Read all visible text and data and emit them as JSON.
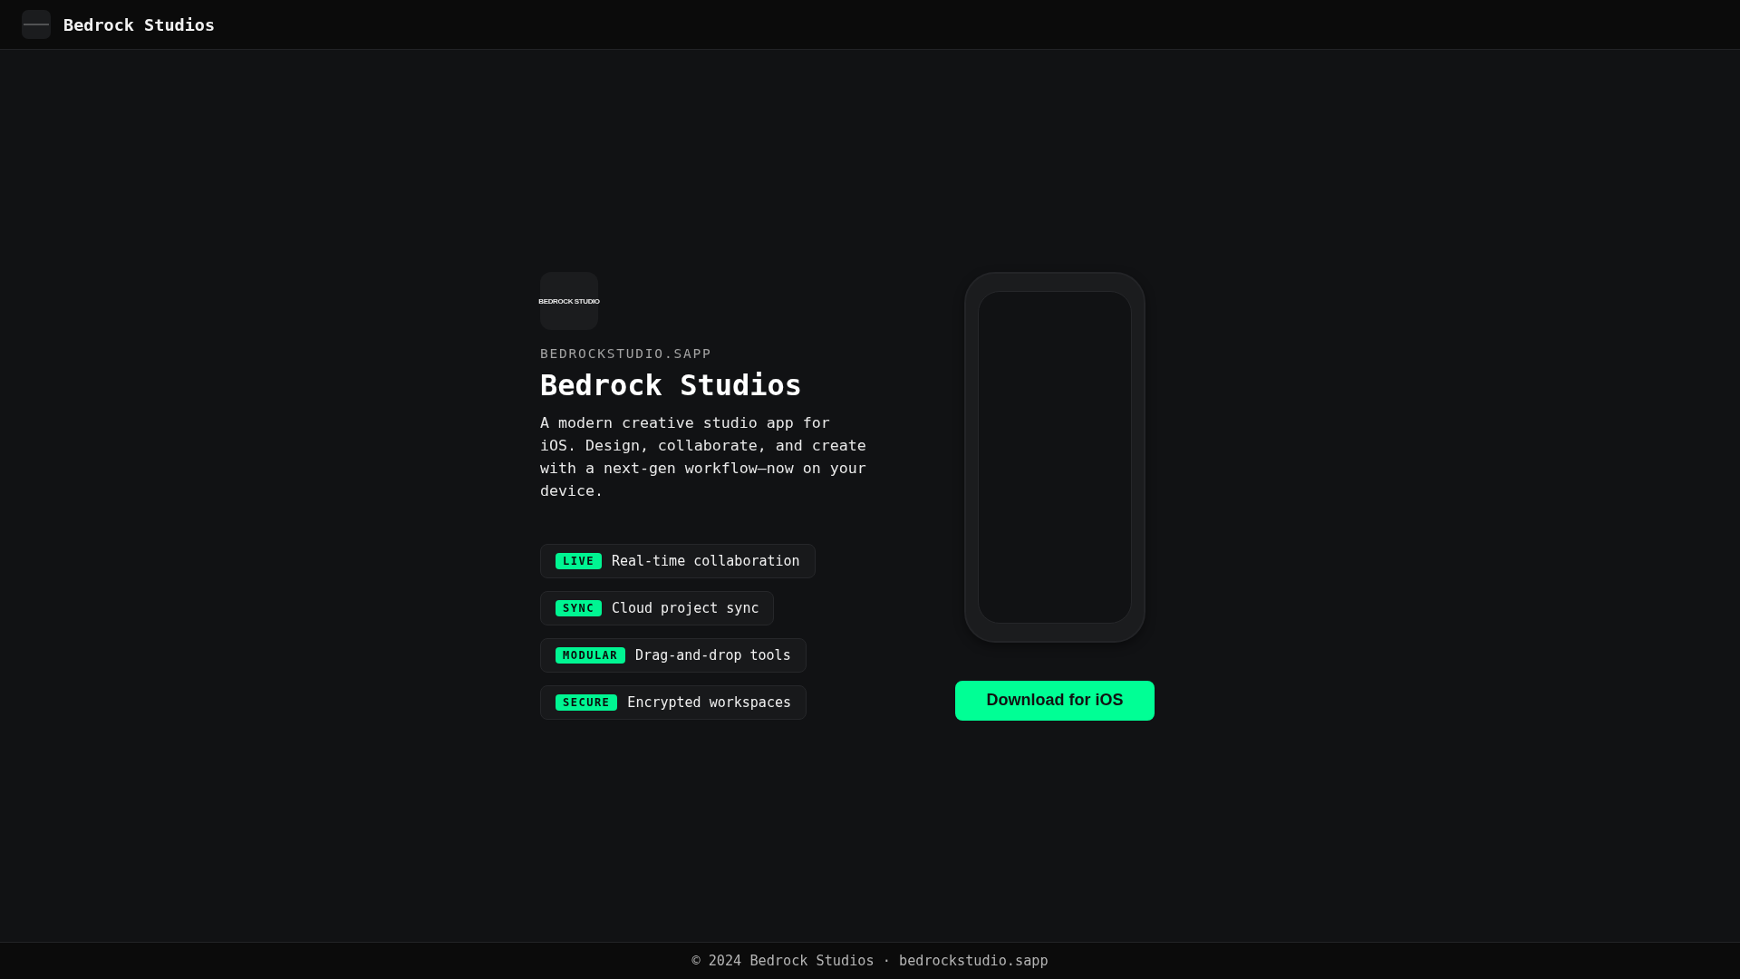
{
  "header": {
    "title": "Bedrock Studios"
  },
  "hero": {
    "logo_text": "BEDROCK STUDIO",
    "eyebrow": "BEDROCKSTUDIO.SAPP",
    "title": "Bedrock Studios",
    "description": "A modern creative studio app for iOS. Design, collaborate, and create with a next-gen workflow—now on your device.",
    "features": [
      {
        "badge": "LIVE",
        "label": "Real-time collaboration"
      },
      {
        "badge": "SYNC",
        "label": "Cloud project sync"
      },
      {
        "badge": "MODULAR",
        "label": "Drag-and-drop tools"
      },
      {
        "badge": "SECURE",
        "label": "Encrypted workspaces"
      }
    ],
    "download_button": "Download for iOS"
  },
  "footer": {
    "text": "© 2024 Bedrock Studios · bedrockstudio.sapp"
  }
}
